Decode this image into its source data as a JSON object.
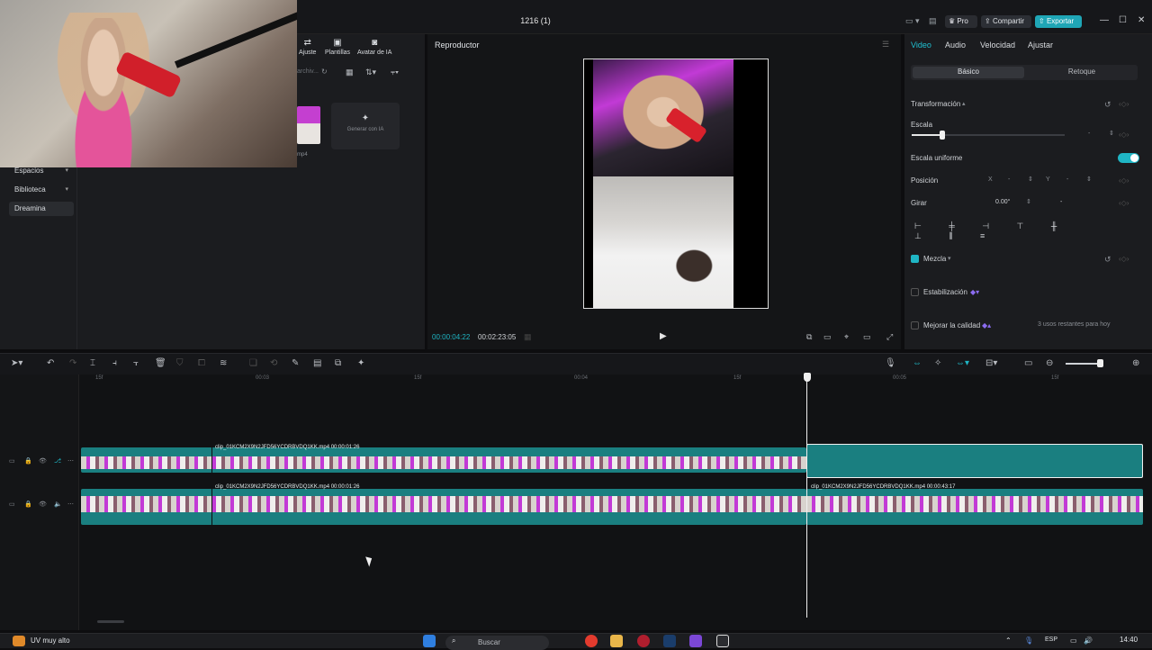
{
  "window": {
    "title": "1216 (1)",
    "pro_label": "Pro",
    "share_label": "Compartir",
    "export_label": "Exportar"
  },
  "media": {
    "tools": [
      "Ajuste",
      "Plantillas",
      "Avatar de IA"
    ],
    "search_placeholder": "archiv...",
    "thumb_label": "mp4",
    "generate_label": "Generar con IA",
    "sidebar": [
      "Espacios",
      "Biblioteca",
      "Dreamina"
    ]
  },
  "player": {
    "title": "Reproductor",
    "current_time": "00:00:04:22",
    "total_time": "00:02:23:05"
  },
  "inspector": {
    "tabs": [
      "Video",
      "Audio",
      "Velocidad",
      "Ajustar"
    ],
    "segments": [
      "Básico",
      "Retoque"
    ],
    "transform_label": "Transformación",
    "scale_label": "Escala",
    "scale_value": "-",
    "uniform_scale_label": "Escala uniforme",
    "position_label": "Posición",
    "x_label": "X",
    "x_value": "-",
    "y_label": "Y",
    "y_value": "-",
    "rotate_label": "Girar",
    "rotate_value": "0.00°",
    "rotate_minus": "-",
    "blend_label": "Mezcla",
    "stabilize_label": "Estabilización",
    "quality_label": "Mejorar la calidad",
    "quality_note": "3 usos restantes para hoy",
    "accent": "#1fb5c4"
  },
  "timeline": {
    "ruler": [
      "15f",
      "00:03",
      "15f",
      "00:04",
      "15f",
      "00:05",
      "15f"
    ],
    "clip_top_label": "clip_01KCM2X9N2JFD56YCDRBVDQ1KK.mp4   00:00:01:26",
    "clip_bottom_label": "clip_01KCM2X9N2JFD56YCDRBVDQ1KK.mp4   00:00:01:26",
    "clip_right_label": "clip_01KCM2X9N2JFD56YCDRBVDQ1KK.mp4   00:00:43:17",
    "clip_color": "#1a7f80"
  },
  "taskbar": {
    "weather": "UV muy alto",
    "search_placeholder": "Buscar",
    "language": "ESP",
    "time": "14:40"
  }
}
